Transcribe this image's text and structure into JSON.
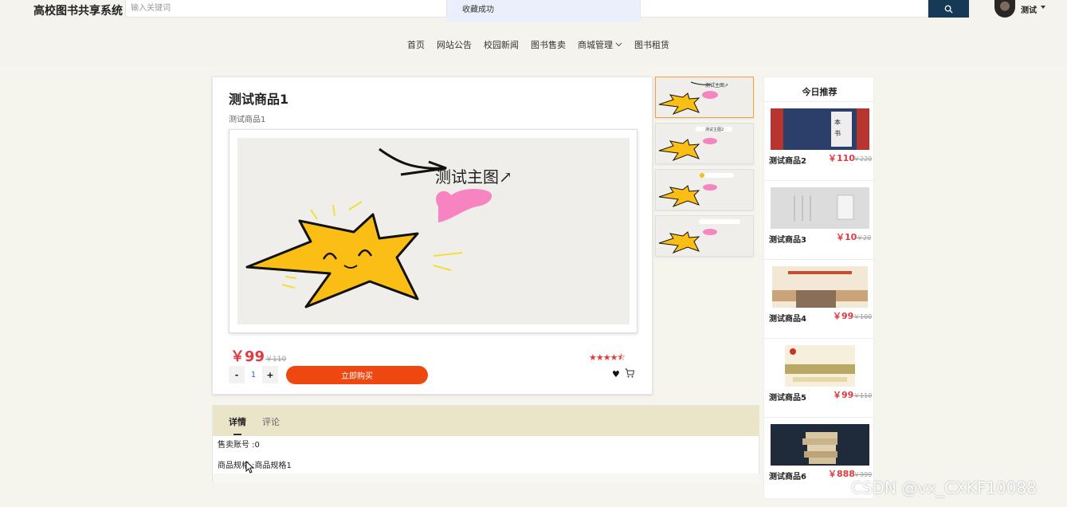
{
  "header": {
    "brand": "高校图书共享系统",
    "search_placeholder": "输入关键词",
    "toast": "收藏成功",
    "user_name": "测试"
  },
  "nav": [
    "首页",
    "网站公告",
    "校园新闻",
    "图书售卖",
    "商城管理",
    "图书租赁"
  ],
  "product": {
    "title": "测试商品1",
    "subtitle": "测试商品1",
    "main_image_caption": "测试主图↗",
    "price": "￥99",
    "price_old": "￥110",
    "rating": 4.5,
    "stars": "★★★★⯪",
    "quantity": "1",
    "minus": "-",
    "plus": "+",
    "buy_label": "立即购买"
  },
  "tabs": {
    "details": "详情",
    "comments": "评论"
  },
  "details": {
    "line1": "售卖账号 :0",
    "line2": "商品规格 :商品规格1"
  },
  "recommend": {
    "title": "今日推荐",
    "items": [
      {
        "name": "测试商品2",
        "price": "￥110",
        "old": "￥220"
      },
      {
        "name": "测试商品3",
        "price": "￥10",
        "old": "￥20"
      },
      {
        "name": "测试商品4",
        "price": "￥99",
        "old": "￥100"
      },
      {
        "name": "测试商品5",
        "price": "￥99",
        "old": "￥110"
      },
      {
        "name": "测试商品6",
        "price": "￥888",
        "old": "￥999"
      }
    ]
  },
  "watermark": "CSDN @vx_CXKF10088",
  "colors": {
    "accent_red": "#e4393c",
    "buy_orange": "#ef4710",
    "search_button": "#163955",
    "tabbar": "#eae5c8"
  }
}
